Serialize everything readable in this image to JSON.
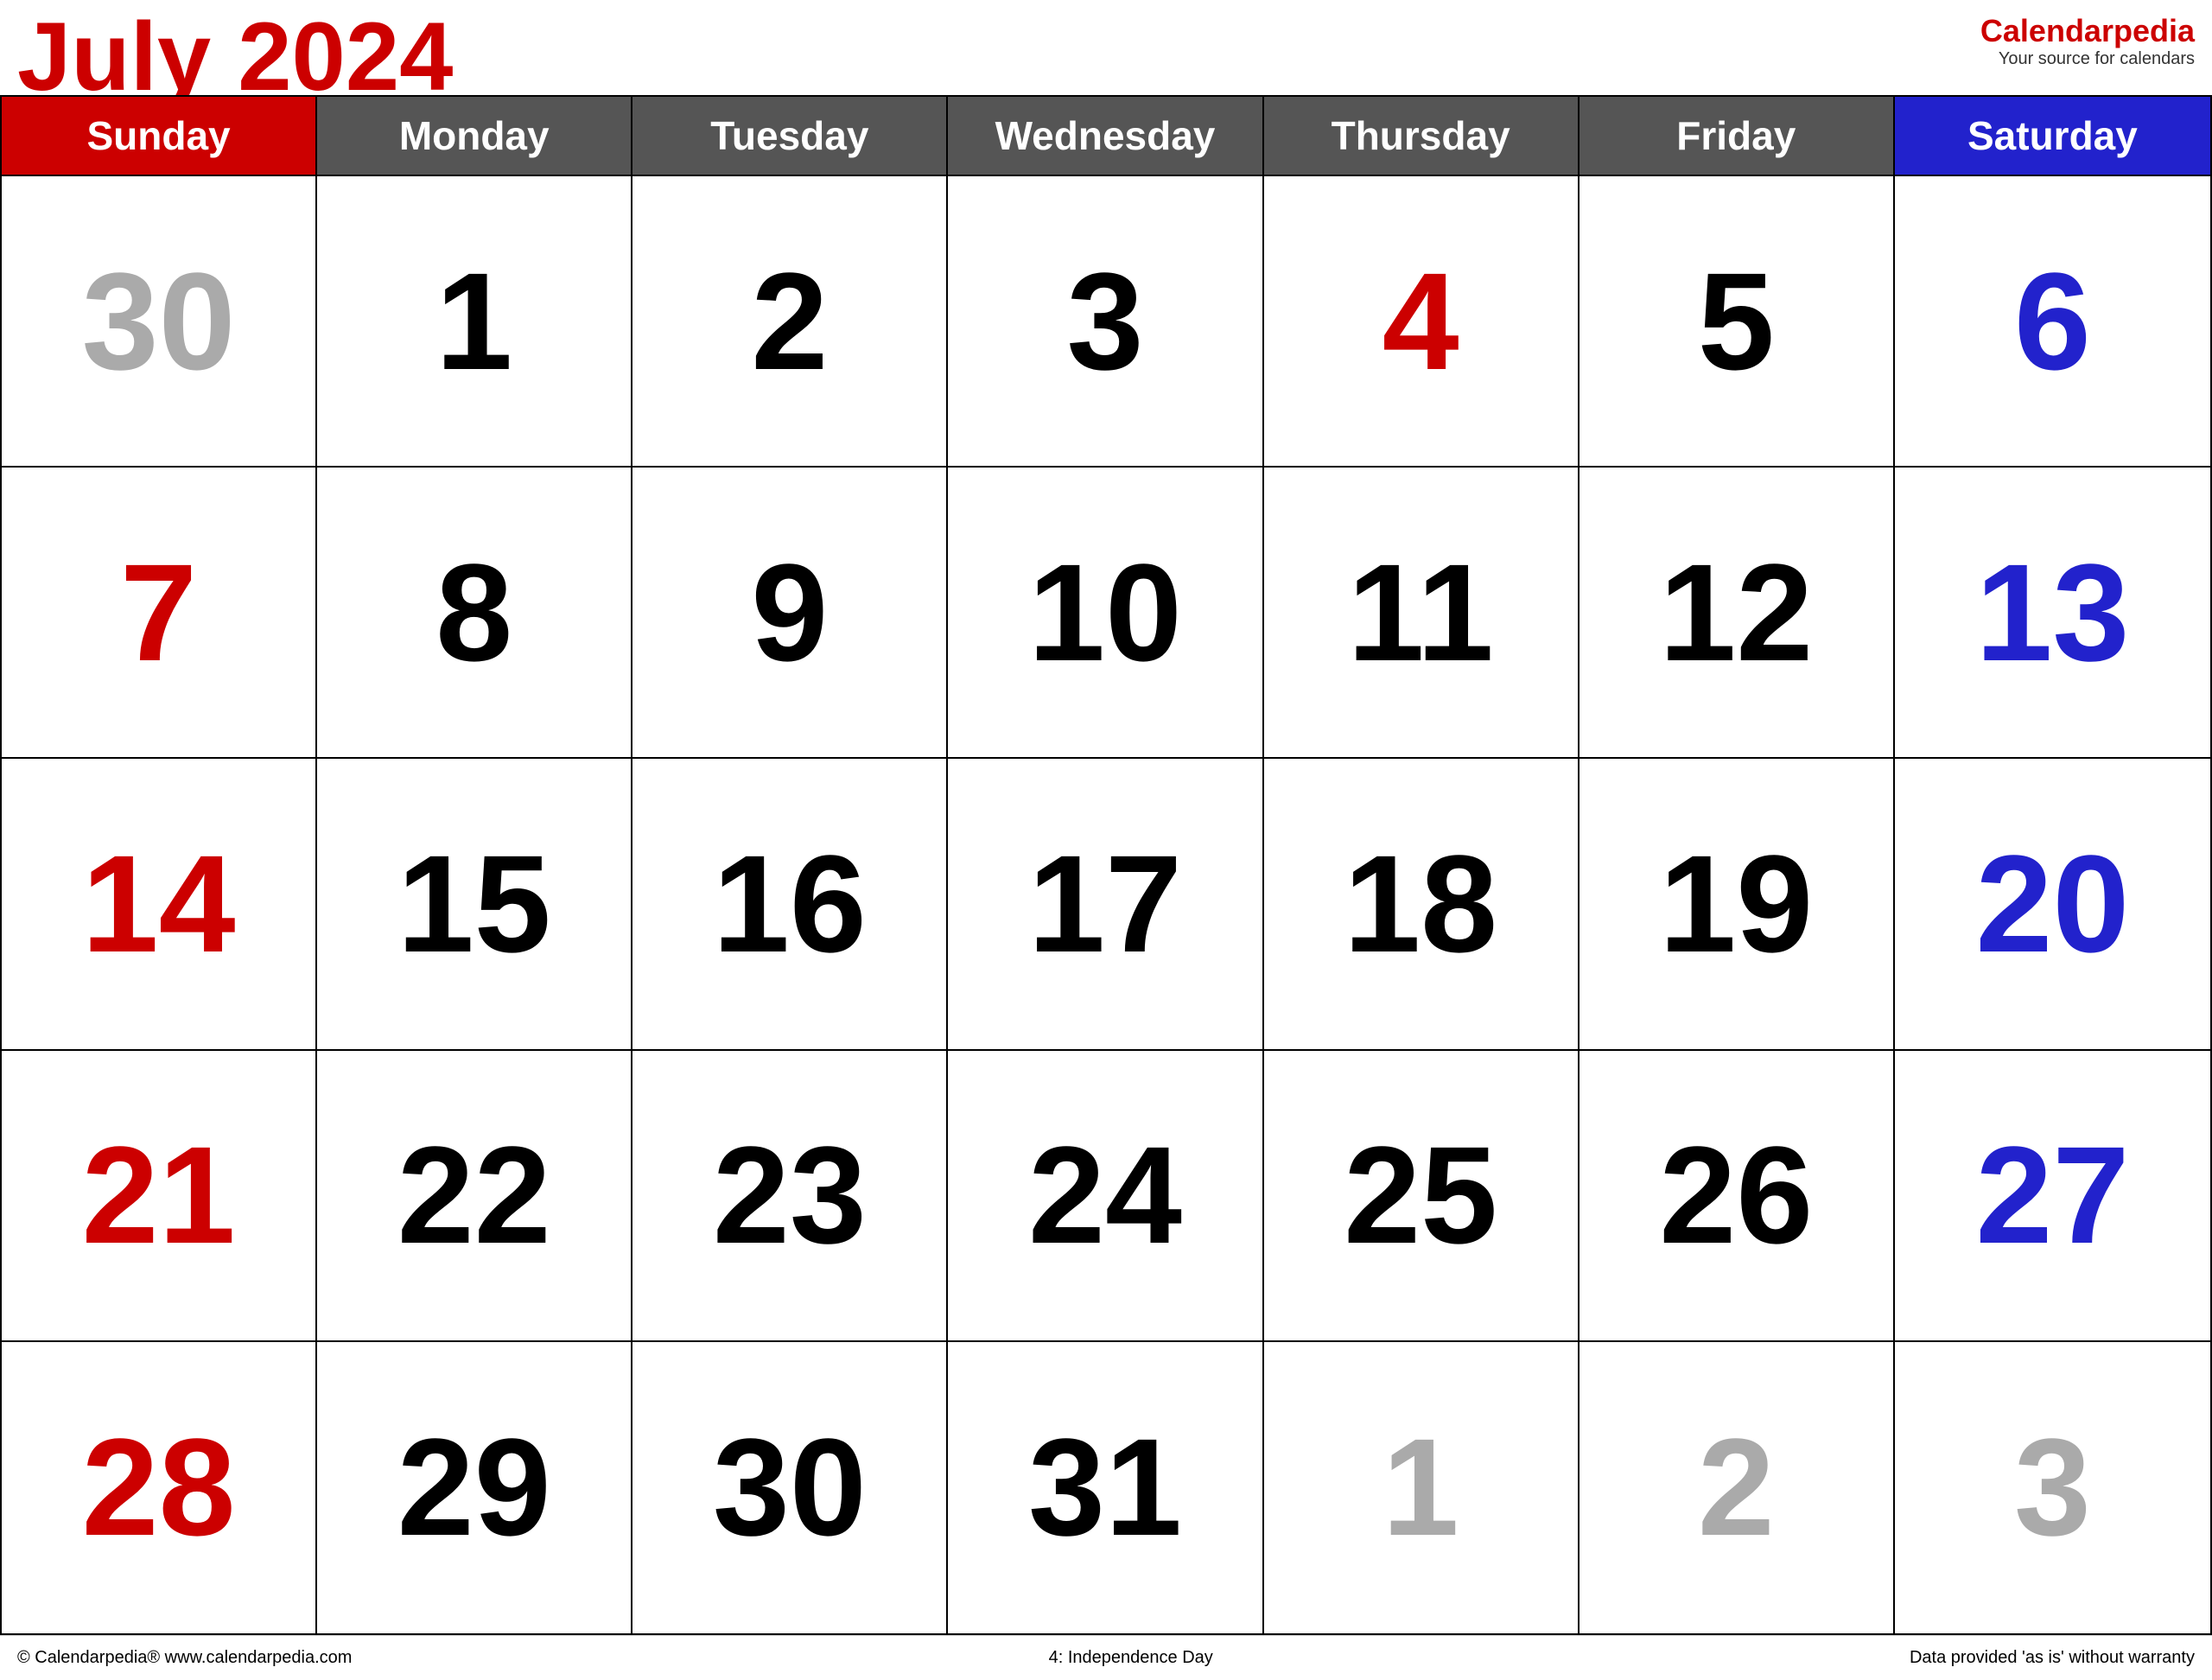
{
  "header": {
    "month": "July",
    "year": "2024",
    "brand_name": "Calendar",
    "brand_name_accent": "pedia",
    "brand_tagline": "Your source for calendars"
  },
  "day_headers": [
    {
      "label": "Sunday",
      "type": "sunday"
    },
    {
      "label": "Monday",
      "type": "weekday"
    },
    {
      "label": "Tuesday",
      "type": "weekday"
    },
    {
      "label": "Wednesday",
      "type": "weekday"
    },
    {
      "label": "Thursday",
      "type": "weekday"
    },
    {
      "label": "Friday",
      "type": "weekday"
    },
    {
      "label": "Saturday",
      "type": "saturday"
    }
  ],
  "weeks": [
    [
      {
        "day": "30",
        "type": "dimmed"
      },
      {
        "day": "1",
        "type": "weekday"
      },
      {
        "day": "2",
        "type": "weekday"
      },
      {
        "day": "3",
        "type": "weekday"
      },
      {
        "day": "4",
        "type": "holiday"
      },
      {
        "day": "5",
        "type": "weekday"
      },
      {
        "day": "6",
        "type": "saturday"
      }
    ],
    [
      {
        "day": "7",
        "type": "sunday"
      },
      {
        "day": "8",
        "type": "weekday"
      },
      {
        "day": "9",
        "type": "weekday"
      },
      {
        "day": "10",
        "type": "weekday"
      },
      {
        "day": "11",
        "type": "weekday"
      },
      {
        "day": "12",
        "type": "weekday"
      },
      {
        "day": "13",
        "type": "saturday"
      }
    ],
    [
      {
        "day": "14",
        "type": "sunday"
      },
      {
        "day": "15",
        "type": "weekday"
      },
      {
        "day": "16",
        "type": "weekday"
      },
      {
        "day": "17",
        "type": "weekday"
      },
      {
        "day": "18",
        "type": "weekday"
      },
      {
        "day": "19",
        "type": "weekday"
      },
      {
        "day": "20",
        "type": "saturday"
      }
    ],
    [
      {
        "day": "21",
        "type": "sunday"
      },
      {
        "day": "22",
        "type": "weekday"
      },
      {
        "day": "23",
        "type": "weekday"
      },
      {
        "day": "24",
        "type": "weekday"
      },
      {
        "day": "25",
        "type": "weekday"
      },
      {
        "day": "26",
        "type": "weekday"
      },
      {
        "day": "27",
        "type": "saturday"
      }
    ],
    [
      {
        "day": "28",
        "type": "sunday"
      },
      {
        "day": "29",
        "type": "weekday"
      },
      {
        "day": "30",
        "type": "weekday"
      },
      {
        "day": "31",
        "type": "weekday"
      },
      {
        "day": "1",
        "type": "dimmed"
      },
      {
        "day": "2",
        "type": "dimmed"
      },
      {
        "day": "3",
        "type": "dimmed"
      }
    ]
  ],
  "footer": {
    "left": "© Calendarpedia®   www.calendarpedia.com",
    "center": "4: Independence Day",
    "right": "Data provided 'as is' without warranty"
  },
  "colors": {
    "sunday_red": "#cc0000",
    "saturday_blue": "#2222cc",
    "holiday_red": "#cc0000",
    "dimmed_gray": "#aaaaaa",
    "header_sunday_bg": "#cc0000",
    "header_saturday_bg": "#2222cc",
    "header_weekday_bg": "#555555"
  }
}
